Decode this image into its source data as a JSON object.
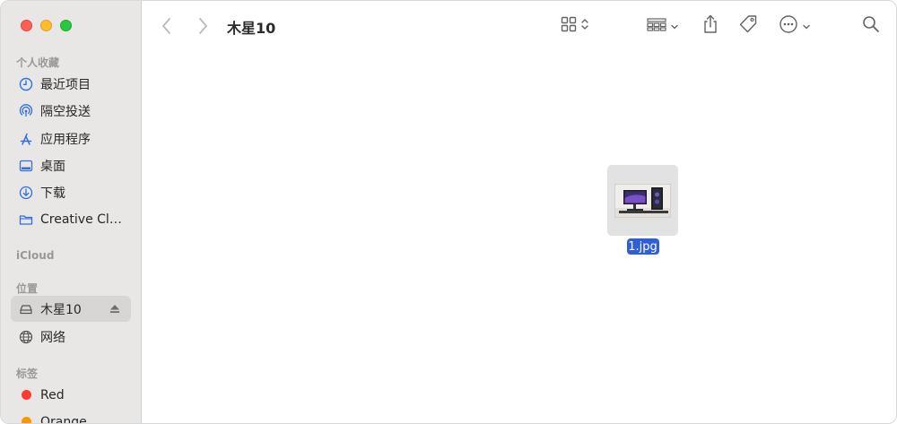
{
  "window": {
    "title": "木星10"
  },
  "sidebar": {
    "favorites_title": "个人收藏",
    "favorites": [
      {
        "label": "最近项目",
        "icon": "clock-icon"
      },
      {
        "label": "隔空投送",
        "icon": "airdrop-icon"
      },
      {
        "label": "应用程序",
        "icon": "applications-icon"
      },
      {
        "label": "桌面",
        "icon": "desktop-icon"
      },
      {
        "label": "下载",
        "icon": "download-icon"
      },
      {
        "label": "Creative Clo...",
        "icon": "folder-icon"
      }
    ],
    "icloud_title": "iCloud",
    "locations_title": "位置",
    "locations": [
      {
        "label": "木星10",
        "icon": "drive-icon",
        "selected": true
      },
      {
        "label": "网络",
        "icon": "network-icon"
      }
    ],
    "tags_title": "标签",
    "tags": [
      {
        "label": "Red",
        "color": "#ff3b30"
      },
      {
        "label": "Orange",
        "color": "#ff9500"
      }
    ]
  },
  "toolbar": {
    "view_icon": "grid-view-icon",
    "group_icon": "group-icon",
    "share_icon": "share-icon",
    "tag_icon": "tag-icon",
    "more_icon": "more-icon",
    "search_icon": "search-icon"
  },
  "content": {
    "files": [
      {
        "name": "1.jpg",
        "selected": true
      }
    ]
  },
  "colors": {
    "accent": "#2f5fd8",
    "sidebar_bg": "#e9e7e6",
    "icon_blue": "#2f6fe4"
  }
}
